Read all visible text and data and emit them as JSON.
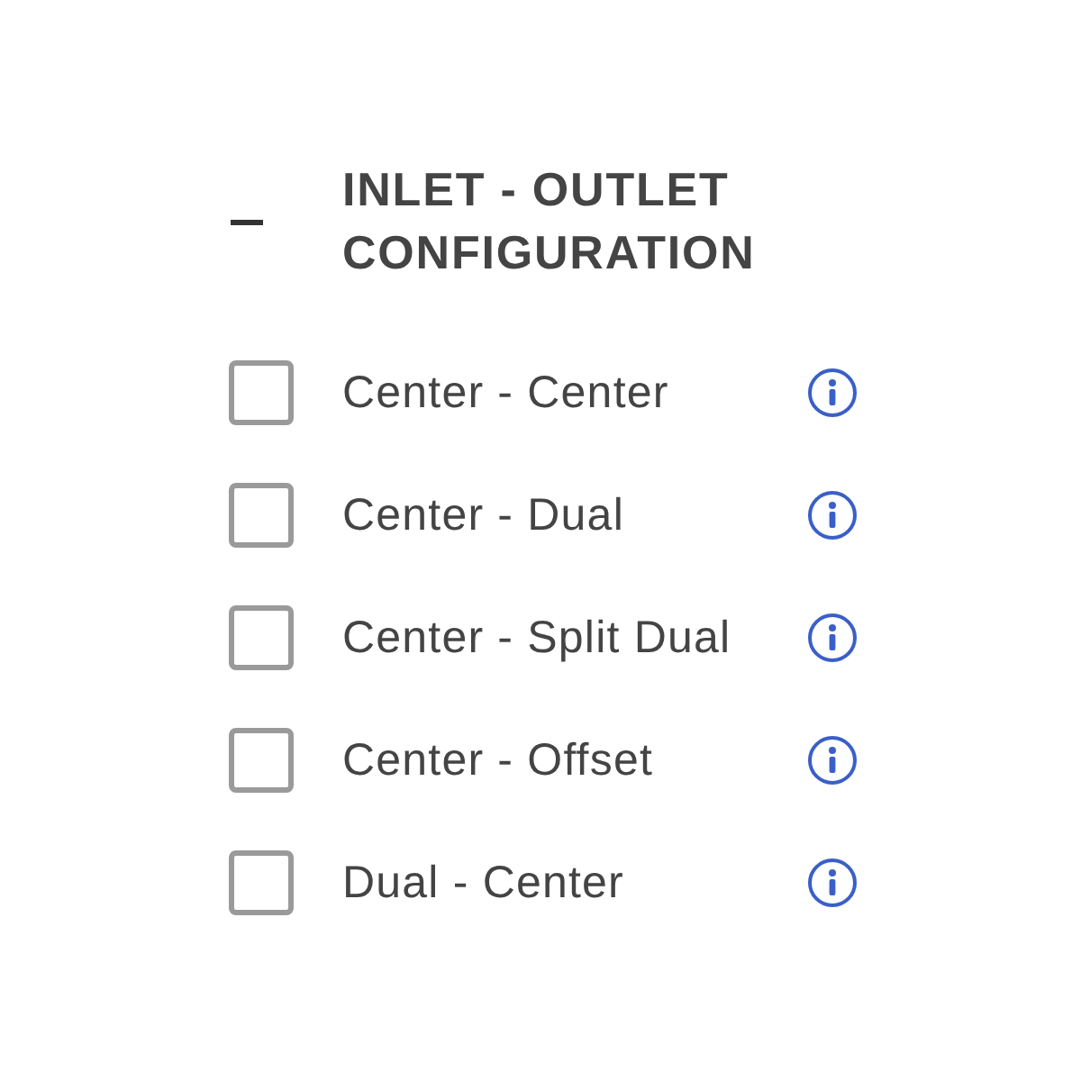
{
  "filter_group": {
    "title": "INLET - OUTLET CONFIGURATION",
    "expanded": true,
    "options": [
      {
        "label": "Center - Center",
        "checked": false
      },
      {
        "label": "Center - Dual",
        "checked": false
      },
      {
        "label": "Center - Split Dual",
        "checked": false
      },
      {
        "label": "Center - Offset",
        "checked": false
      },
      {
        "label": "Dual - Center",
        "checked": false
      }
    ]
  }
}
